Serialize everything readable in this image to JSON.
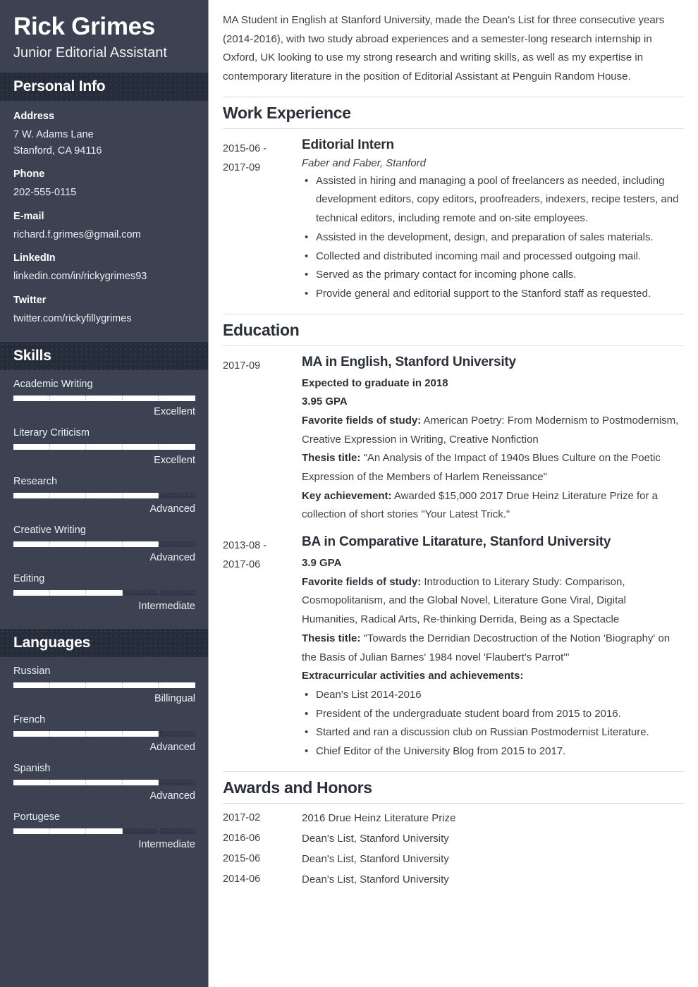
{
  "theme": {
    "sidebar_bg": "#3c4252",
    "sidebar_band_bg": "#262d3a",
    "bar_fill": "#ffffff",
    "bar_track": "#323847",
    "text_dark": "#2b3038",
    "rule": "#dcdde0"
  },
  "sidebar": {
    "name": "Rick Grimes",
    "job_title": "Junior Editorial Assistant",
    "personal_info": {
      "heading": "Personal Info",
      "items": [
        {
          "label": "Address",
          "value": "7 W. Adams Lane\nStanford, CA 94116"
        },
        {
          "label": "Phone",
          "value": "202-555-0115"
        },
        {
          "label": "E-mail",
          "value": "richard.f.grimes@gmail.com"
        },
        {
          "label": "LinkedIn",
          "value": "linkedin.com/in/rickygrimes93"
        },
        {
          "label": "Twitter",
          "value": "twitter.com/rickyfillygrimes"
        }
      ]
    },
    "skills": {
      "heading": "Skills",
      "items": [
        {
          "name": "Academic Writing",
          "level": "Excellent",
          "percent": 100
        },
        {
          "name": "Literary Criticism",
          "level": "Excellent",
          "percent": 100
        },
        {
          "name": "Research",
          "level": "Advanced",
          "percent": 80
        },
        {
          "name": "Creative Writing",
          "level": "Advanced",
          "percent": 80
        },
        {
          "name": "Editing",
          "level": "Intermediate",
          "percent": 60
        }
      ]
    },
    "languages": {
      "heading": "Languages",
      "items": [
        {
          "name": "Russian",
          "level": "Billingual",
          "percent": 100
        },
        {
          "name": "French",
          "level": "Advanced",
          "percent": 80
        },
        {
          "name": "Spanish",
          "level": "Advanced",
          "percent": 80
        },
        {
          "name": "Portugese",
          "level": "Intermediate",
          "percent": 60
        }
      ]
    }
  },
  "main": {
    "summary": "MA Student in English at Stanford University, made the Dean's List for three consecutive years (2014-2016), with two study abroad experiences and a semester-long research internship in Oxford, UK looking to use my strong research and writing skills, as well as my expertise in contemporary literature in the position of Editorial Assistant at Penguin Random House.",
    "work_experience": {
      "heading": "Work Experience",
      "entries": [
        {
          "dates": "2015-06 -\n2017-09",
          "role": "Editorial Intern",
          "organization": "Faber and Faber, Stanford",
          "bullets": [
            "Assisted in hiring and managing a pool of freelancers as needed, including development editors, copy editors, proofreaders, indexers, recipe testers, and technical editors, including remote and on-site employees.",
            "Assisted in the development, design, and preparation of sales materials.",
            "Collected and distributed incoming mail and processed outgoing mail.",
            "Served as the primary contact for incoming phone calls.",
            "Provide general and editorial support to the Stanford staff as requested."
          ]
        }
      ]
    },
    "education": {
      "heading": "Education",
      "entries": [
        {
          "dates": "2017-09",
          "degree": "MA in English, Stanford University",
          "details": [
            {
              "bold_all": true,
              "label": "Expected to graduate in 2018",
              "text": ""
            },
            {
              "bold_all": true,
              "label": "3.95 GPA",
              "text": ""
            },
            {
              "bold_all": false,
              "label": "Favorite fields of study:",
              "text": " American Poetry: From Modernism to Postmodernism, Creative Expression in Writing, Creative Nonfiction"
            },
            {
              "bold_all": false,
              "label": "Thesis title:",
              "text": " \"An Analysis of the Impact of 1940s Blues Culture on the Poetic Expression of the Members of Harlem Reneissance\""
            },
            {
              "bold_all": false,
              "label": "Key achievement:",
              "text": " Awarded $15,000 2017 Drue Heinz Literature Prize for a collection of short stories \"Your Latest Trick.\""
            }
          ],
          "bullets": []
        },
        {
          "dates": "2013-08 -\n2017-06",
          "degree": "BA in Comparative Litarature, Stanford University",
          "details": [
            {
              "bold_all": true,
              "label": "3.9 GPA",
              "text": ""
            },
            {
              "bold_all": false,
              "label": "Favorite fields of study:",
              "text": " Introduction to Literary Study: Comparison, Cosmopolitanism, and the Global Novel, Literature Gone Viral, Digital Humanities, Radical Arts, Re-thinking Derrida, Being as a Spectacle"
            },
            {
              "bold_all": false,
              "label": "Thesis title:",
              "text": " \"Towards the Derridian Decostruction of the Notion 'Biography' on the Basis of Julian Barnes' 1984 novel 'Flaubert's Parrot'\""
            },
            {
              "bold_all": true,
              "label": "Extracurricular activities and achievements:",
              "text": ""
            }
          ],
          "bullets": [
            "Dean's List 2014-2016",
            "President of the undergraduate student board from 2015 to 2016.",
            "Started and ran a discussion club on Russian Postmodernist Literature.",
            "Chief Editor of the University Blog from 2015 to 2017."
          ]
        }
      ]
    },
    "awards": {
      "heading": "Awards and Honors",
      "rows": [
        {
          "date": "2017-02",
          "text": "2016 Drue Heinz Literature Prize"
        },
        {
          "date": "2016-06",
          "text": "Dean's List, Stanford University"
        },
        {
          "date": "2015-06",
          "text": "Dean's List, Stanford University"
        },
        {
          "date": "2014-06",
          "text": "Dean's List, Stanford University"
        }
      ]
    }
  }
}
